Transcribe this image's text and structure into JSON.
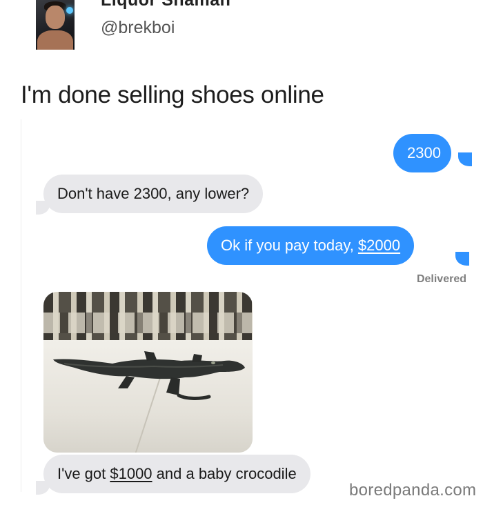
{
  "post": {
    "display_name": "Liquor Shaman",
    "handle": "@brekboi",
    "text": "I'm done selling shoes online"
  },
  "conversation": {
    "messages": [
      {
        "from": "me",
        "text": "2300"
      },
      {
        "from": "them",
        "text": "Don't have 2300, any lower?"
      },
      {
        "from": "me",
        "text_pre": "Ok if you pay today, ",
        "text_link": "$2000"
      },
      {
        "from": "them",
        "type": "photo",
        "alt_icon": "baby-crocodile-photo"
      },
      {
        "from": "them",
        "text_pre": "I've got ",
        "text_link": "$1000",
        "text_post": " and a baby crocodile"
      }
    ],
    "status": "Delivered"
  },
  "watermark": "boredpanda.com",
  "colors": {
    "sent_bubble": "#2f92ff",
    "received_bubble": "#e8e8eb",
    "status_text": "#7f7f7f"
  }
}
